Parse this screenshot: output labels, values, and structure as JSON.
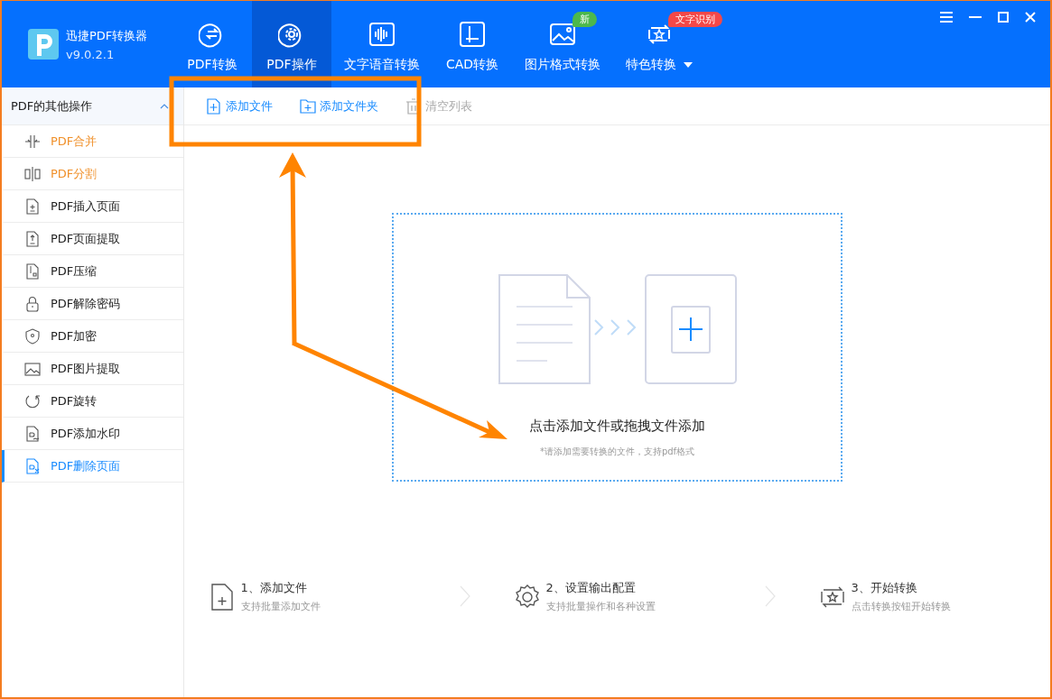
{
  "app": {
    "name": "迅捷PDF转换器",
    "version": "v9.0.2.1"
  },
  "tabs": [
    {
      "label": "PDF转换",
      "selected": false
    },
    {
      "label": "PDF操作",
      "selected": true
    },
    {
      "label": "文字语音转换",
      "selected": false
    },
    {
      "label": "CAD转换",
      "selected": false
    },
    {
      "label": "图片格式转换",
      "selected": false,
      "badge": "新",
      "color": "#4cb84c"
    },
    {
      "label": "特色转换",
      "selected": false,
      "badge": "文字识别",
      "color": "#f44848",
      "dropdown": true
    }
  ],
  "sidebar": {
    "title": "PDF的其他操作",
    "expanded": true,
    "items": [
      {
        "label": "PDF合并",
        "featured": true,
        "selected": false
      },
      {
        "label": "PDF分割",
        "featured": true,
        "selected": false
      },
      {
        "label": "PDF插入页面",
        "featured": false,
        "selected": false
      },
      {
        "label": "PDF页面提取",
        "featured": false,
        "selected": false
      },
      {
        "label": "PDF压缩",
        "featured": false,
        "selected": false
      },
      {
        "label": "PDF解除密码",
        "featured": false,
        "selected": false
      },
      {
        "label": "PDF加密",
        "featured": false,
        "selected": false
      },
      {
        "label": "PDF图片提取",
        "featured": false,
        "selected": false
      },
      {
        "label": "PDF旋转",
        "featured": false,
        "selected": false
      },
      {
        "label": "PDF添加水印",
        "featured": false,
        "selected": false
      },
      {
        "label": "PDF删除页面",
        "featured": false,
        "selected": true
      }
    ]
  },
  "toolbar": [
    {
      "label": "添加文件",
      "disabled": false
    },
    {
      "label": "添加文件夹",
      "disabled": false
    },
    {
      "label": "清空列表",
      "disabled": true
    }
  ],
  "dropzone": {
    "title": "点击添加文件或拖拽文件添加",
    "hint": "*请添加需要转换的文件，支持pdf格式"
  },
  "steps": [
    {
      "title": "1、添加文件",
      "subtitle": "支持批量添加文件"
    },
    {
      "title": "2、设置输出配置",
      "subtitle": "支持批量操作和各种设置"
    },
    {
      "title": "3、开始转换",
      "subtitle": "点击转换按钮开始转换"
    }
  ]
}
